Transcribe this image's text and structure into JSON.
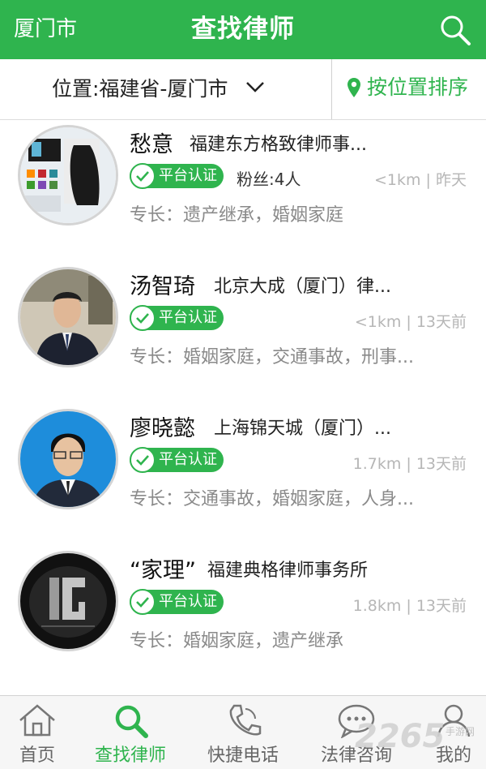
{
  "header": {
    "city": "厦门市",
    "title": "查找律师"
  },
  "filter": {
    "location": "位置:福建省-厦门市",
    "sort": "按位置排序"
  },
  "lawyers": [
    {
      "name": "愁意",
      "firm": "福建东方格致律师事...",
      "badge": "平台认证",
      "fans": "粉丝:4人",
      "meta": "<1km | 昨天",
      "specialty": "专长：遗产继承，婚姻家庭"
    },
    {
      "name": "汤智琦",
      "firm": "北京大成（厦门）律...",
      "badge": "平台认证",
      "fans": "",
      "meta": "<1km | 13天前",
      "specialty": "专长：婚姻家庭，交通事故，刑事..."
    },
    {
      "name": "廖晓懿",
      "firm": "上海锦天城（厦门）...",
      "badge": "平台认证",
      "fans": "",
      "meta": "1.7km | 13天前",
      "specialty": "专长：交通事故，婚姻家庭，人身..."
    },
    {
      "name": "“家理”",
      "firm": "福建典格律师事务所",
      "badge": "平台认证",
      "fans": "",
      "meta": "1.8km | 13天前",
      "specialty": "专长：婚姻家庭，遗产继承"
    }
  ],
  "tabs": [
    {
      "label": "首页",
      "icon": "home-icon"
    },
    {
      "label": "查找律师",
      "icon": "search-icon"
    },
    {
      "label": "快捷电话",
      "icon": "phone-icon"
    },
    {
      "label": "法律咨询",
      "icon": "chat-icon"
    },
    {
      "label": "我的",
      "icon": "user-icon"
    }
  ],
  "watermark": {
    "number": "2265",
    "sub": "手游网"
  },
  "colors": {
    "brand": "#2fb44e",
    "muted": "#8a8a8a",
    "meta": "#b6b6b6"
  }
}
